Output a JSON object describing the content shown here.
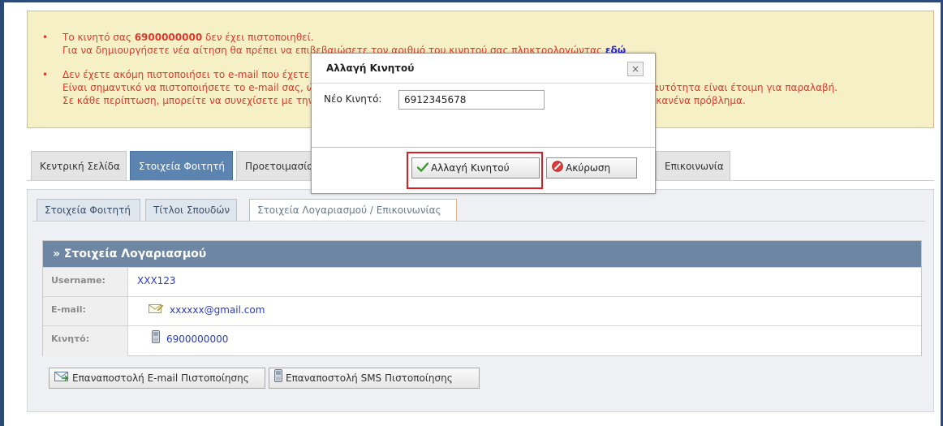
{
  "notice": {
    "l1_pre": "Το κινητό σας ",
    "l1_number": "6900000000",
    "l1_post": " δεν έχει πιστοποιηθεί.",
    "l2_pre": "Για να δημιουργήσετε νέα αίτηση θα πρέπει να επιβεβαιώσετε τον αριθμό του κινητού σας πληκτρολογώντας ",
    "l2_link": "εδώ",
    "l3": "Δεν έχετε ακόμη πιστοποιήσει το e-mail που έχετε δηλώσει.",
    "l4": "Είναι σημαντικό να πιστοποιήσετε το e-mail σας, ώστε να μπορείτε να λάβετε την ειδοποίηση όταν η ακαδημαϊκή σας ταυτότητα είναι έτοιμη για παραλαβή.",
    "l5": "Σε κάθε περίπτωση, μπορείτε να συνεχίσετε με την υποβολή της αίτησής σας και να πιστοποιήσετε το e-mail σας χωρίς κανένα πρόβλημα."
  },
  "main_tabs": {
    "home": "Κεντρική Σελίδα",
    "student": "Στοιχεία Φοιτητή",
    "prep": "Προετοιμασία",
    "contact": "Επικοινωνία"
  },
  "sub_tabs": {
    "student": "Στοιχεία Φοιτητή",
    "degrees": "Τίτλοι Σπουδών",
    "account": "Στοιχεία Λογαριασμού / Επικοινωνίας"
  },
  "account": {
    "heading": "» Στοιχεία Λογαριασμού",
    "username_label": "Username:",
    "username_value": "XXX123",
    "email_label": "E-mail:",
    "email_value": "xxxxxx@gmail.com",
    "mobile_label": "Κινητό:",
    "mobile_value": "6900000000"
  },
  "actions": {
    "resend_email": "Επαναποστολή E-mail Πιστοποίησης",
    "resend_sms": "Επαναποστολή SMS Πιστοποίησης"
  },
  "modal": {
    "title": "Αλλαγή Κινητού",
    "close": "×",
    "field_label": "Νέο Κινητό:",
    "field_value": "6912345678",
    "confirm": "Αλλαγή Κινητού",
    "cancel": "Ακύρωση"
  },
  "icons": {
    "bullet": "•",
    "check": "check-icon",
    "cancel": "cancel-icon",
    "email": "email-icon",
    "phone": "phone-icon"
  },
  "colors": {
    "accent": "#5b84b1",
    "warning_text": "#e0392b",
    "warning_bg": "#f6f0c7",
    "highlight": "#e01b22"
  }
}
